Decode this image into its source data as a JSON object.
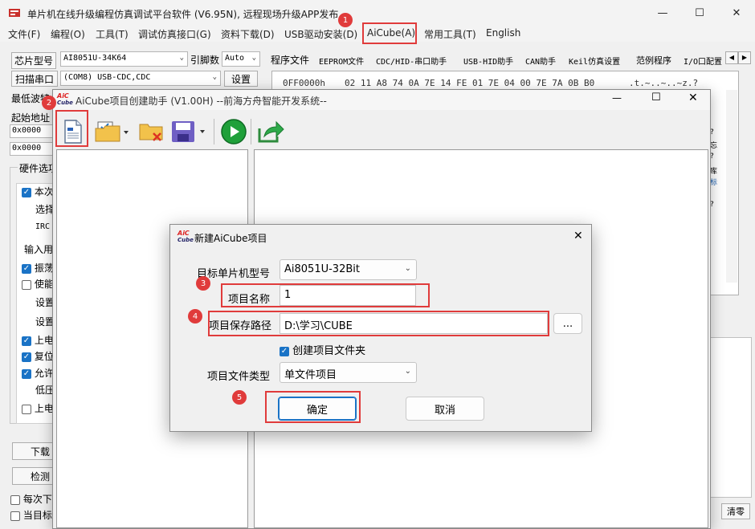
{
  "main": {
    "title": "单片机在线升级编程仿真调试平台软件 (V6.95N), 远程现场升级APP发布",
    "menu": [
      "文件(F)",
      "编程(O)",
      "工具(T)",
      "调试仿真接口(G)",
      "资料下载(D)",
      "USB驱动安装(D)",
      "AiCube(A)",
      "常用工具(T)",
      "English"
    ],
    "chip_label": "芯片型号",
    "chip_value": "AI8051U-34K64",
    "pin_label": "引脚数",
    "pin_value": "Auto",
    "scan_button": "扫描串口",
    "port_value": "(COM8) USB-CDC,CDC",
    "settings_button": "设置",
    "min_baud_label": "最低波特",
    "start_addr_label": "起始地址",
    "addr1": "0x0000",
    "addr2": "0x0000",
    "hw_options_label": "硬件选项",
    "left_options": [
      "本次",
      "选择",
      "IRC",
      "输入用",
      "振荡",
      "使能",
      "设置",
      "设置",
      "上电",
      "复位",
      "允许",
      "低压",
      "上电"
    ],
    "download_button": "下载",
    "check_button": "检测",
    "every_time_label": "每次下",
    "current_label": "当目标",
    "tabs": [
      "程序文件",
      "EEPROM文件",
      "CDC/HID-串口助手",
      "USB-HID助手",
      "CAN助手",
      "Keil仿真设置",
      "范例程序",
      "I/O口配置"
    ],
    "hex_addr": "0FF0000h",
    "hex_bytes": "02 11 A8 74 0A 7E 14 FE 01 7E 04 00 7E 7A 0B B0",
    "hex_ascii": ".t.~..~..~z.?",
    "clear_button": "清零",
    "side_fragments": [
      "?",
      "忘",
      "?",
      "库",
      "标",
      "?"
    ]
  },
  "aicube": {
    "title": "AiCube项目创建助手 (V1.00H) --前海方舟智能开发系统--",
    "logo_top": "AiC",
    "logo_bottom": "Cube"
  },
  "dialog": {
    "title": "新建AiCube项目",
    "mcu_label": "目标单片机型号",
    "mcu_value": "Ai8051U-32Bit",
    "name_label": "项目名称",
    "name_value": "1",
    "path_label": "项目保存路径",
    "path_value": "D:\\学习\\CUBE",
    "browse_button": "...",
    "create_folder_label": "创建项目文件夹",
    "create_folder_checked": true,
    "type_label": "项目文件类型",
    "type_value": "单文件项目",
    "ok_button": "确定",
    "cancel_button": "取消"
  },
  "annotations": [
    "1",
    "2",
    "3",
    "4",
    "5"
  ],
  "colors": {
    "highlight": "#e03b3b",
    "checkbox": "#1a73c6",
    "run_green": "#1fa03a"
  }
}
